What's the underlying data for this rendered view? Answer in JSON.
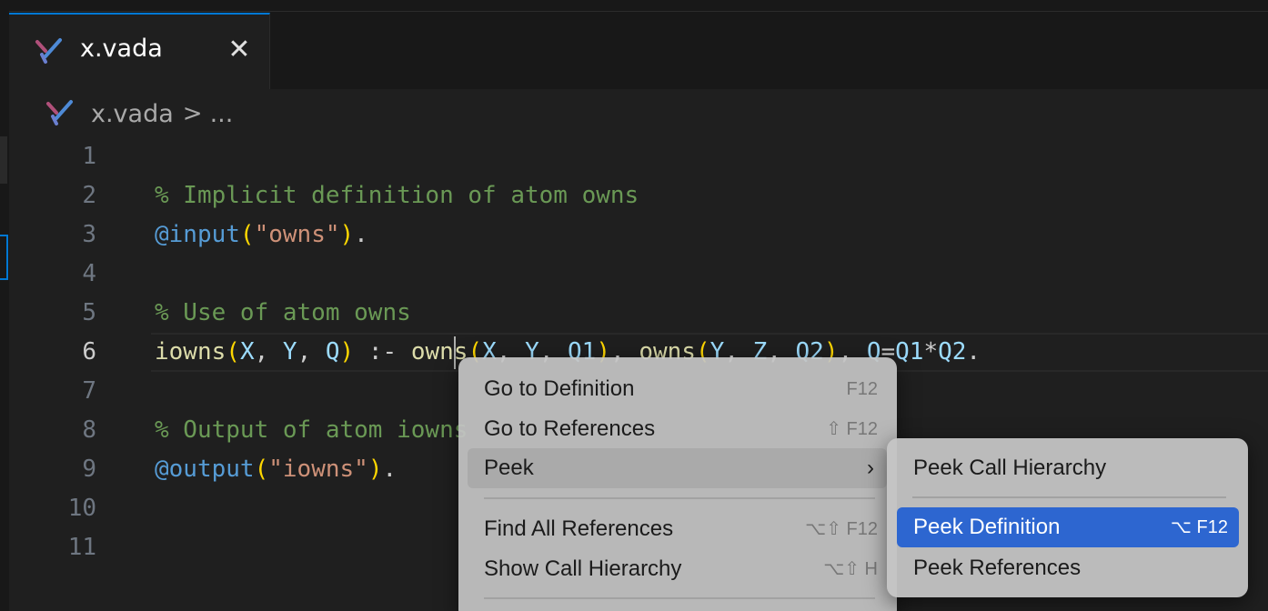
{
  "tab": {
    "title": "x.vada",
    "close_glyph": "✕",
    "icon": "vada-logo-icon"
  },
  "breadcrumb": {
    "file": "x.vada",
    "separator": ">",
    "more": "..."
  },
  "editor": {
    "active_line": 6,
    "lines": [
      {
        "number": "1",
        "code": ""
      },
      {
        "number": "2",
        "code": "% Implicit definition of atom owns"
      },
      {
        "number": "3",
        "code": "@input(\"owns\")."
      },
      {
        "number": "4",
        "code": ""
      },
      {
        "number": "5",
        "code": "% Use of atom owns"
      },
      {
        "number": "6",
        "code": "iowns(X, Y, Q) :- owns(X, Y, Q1), owns(Y, Z, Q2), Q=Q1*Q2."
      },
      {
        "number": "7",
        "code": ""
      },
      {
        "number": "8",
        "code": "% Output of atom iowns"
      },
      {
        "number": "9",
        "code": "@output(\"iowns\")."
      },
      {
        "number": "10",
        "code": ""
      },
      {
        "number": "11",
        "code": ""
      }
    ],
    "colors": {
      "comment": "#6a9955",
      "annotation": "#569cd6",
      "paren": "#ffd700",
      "string": "#ce9178",
      "function": "#dcdcaa",
      "variable": "#9cdcfe"
    }
  },
  "context_menu": {
    "items": [
      {
        "label": "Go to Definition",
        "shortcut": "F12"
      },
      {
        "label": "Go to References",
        "shortcut": "⇧ F12"
      },
      {
        "label": "Peek",
        "arrow": "›"
      },
      {
        "label": "Find All References",
        "shortcut": "⌥⇧ F12"
      },
      {
        "label": "Show Call Hierarchy",
        "shortcut": "⌥⇧ H"
      }
    ]
  },
  "submenu": {
    "items": [
      {
        "label": "Peek Call Hierarchy",
        "shortcut": ""
      },
      {
        "label": "Peek Definition",
        "shortcut": "⌥ F12"
      },
      {
        "label": "Peek References",
        "shortcut": ""
      }
    ]
  },
  "accent_color": "#0078d4",
  "selection_color": "#2d66d0"
}
